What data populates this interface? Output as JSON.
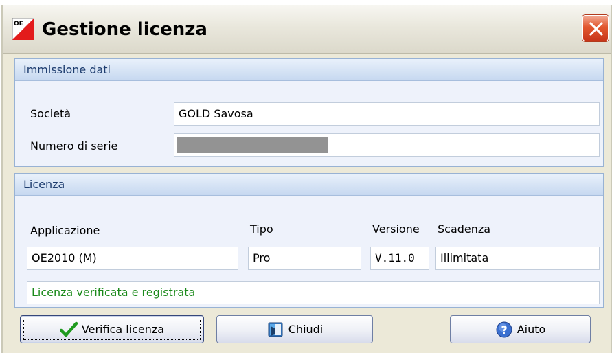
{
  "window": {
    "title": "Gestione licenza",
    "app_icon": "oe-logo-icon",
    "app_icon_text": "OE"
  },
  "data_entry": {
    "header": "Immissione dati",
    "company_label": "Società",
    "company_value": "GOLD Savosa",
    "serial_label": "Numero di serie",
    "serial_value_redacted": true
  },
  "license": {
    "header": "Licenza",
    "application_label": "Applicazione",
    "application_value": "OE2010 (M)",
    "type_label": "Tipo",
    "type_value": "Pro",
    "version_label": "Versione",
    "version_value": "V.11.0",
    "expiry_label": "Scadenza",
    "expiry_value": "Illimitata",
    "status_text": "Licenza verificata e registrata"
  },
  "buttons": {
    "verify_label": "Verifica licenza",
    "verify_icon": "checkmark-icon",
    "close_label": "Chiudi",
    "close_icon": "exit-door-icon",
    "help_label": "Aiuto",
    "help_icon": "help-icon"
  },
  "colors": {
    "status_text": "#1b8a1b",
    "group_header_text": "#1d3c6e",
    "close_button": "#e2582f"
  }
}
